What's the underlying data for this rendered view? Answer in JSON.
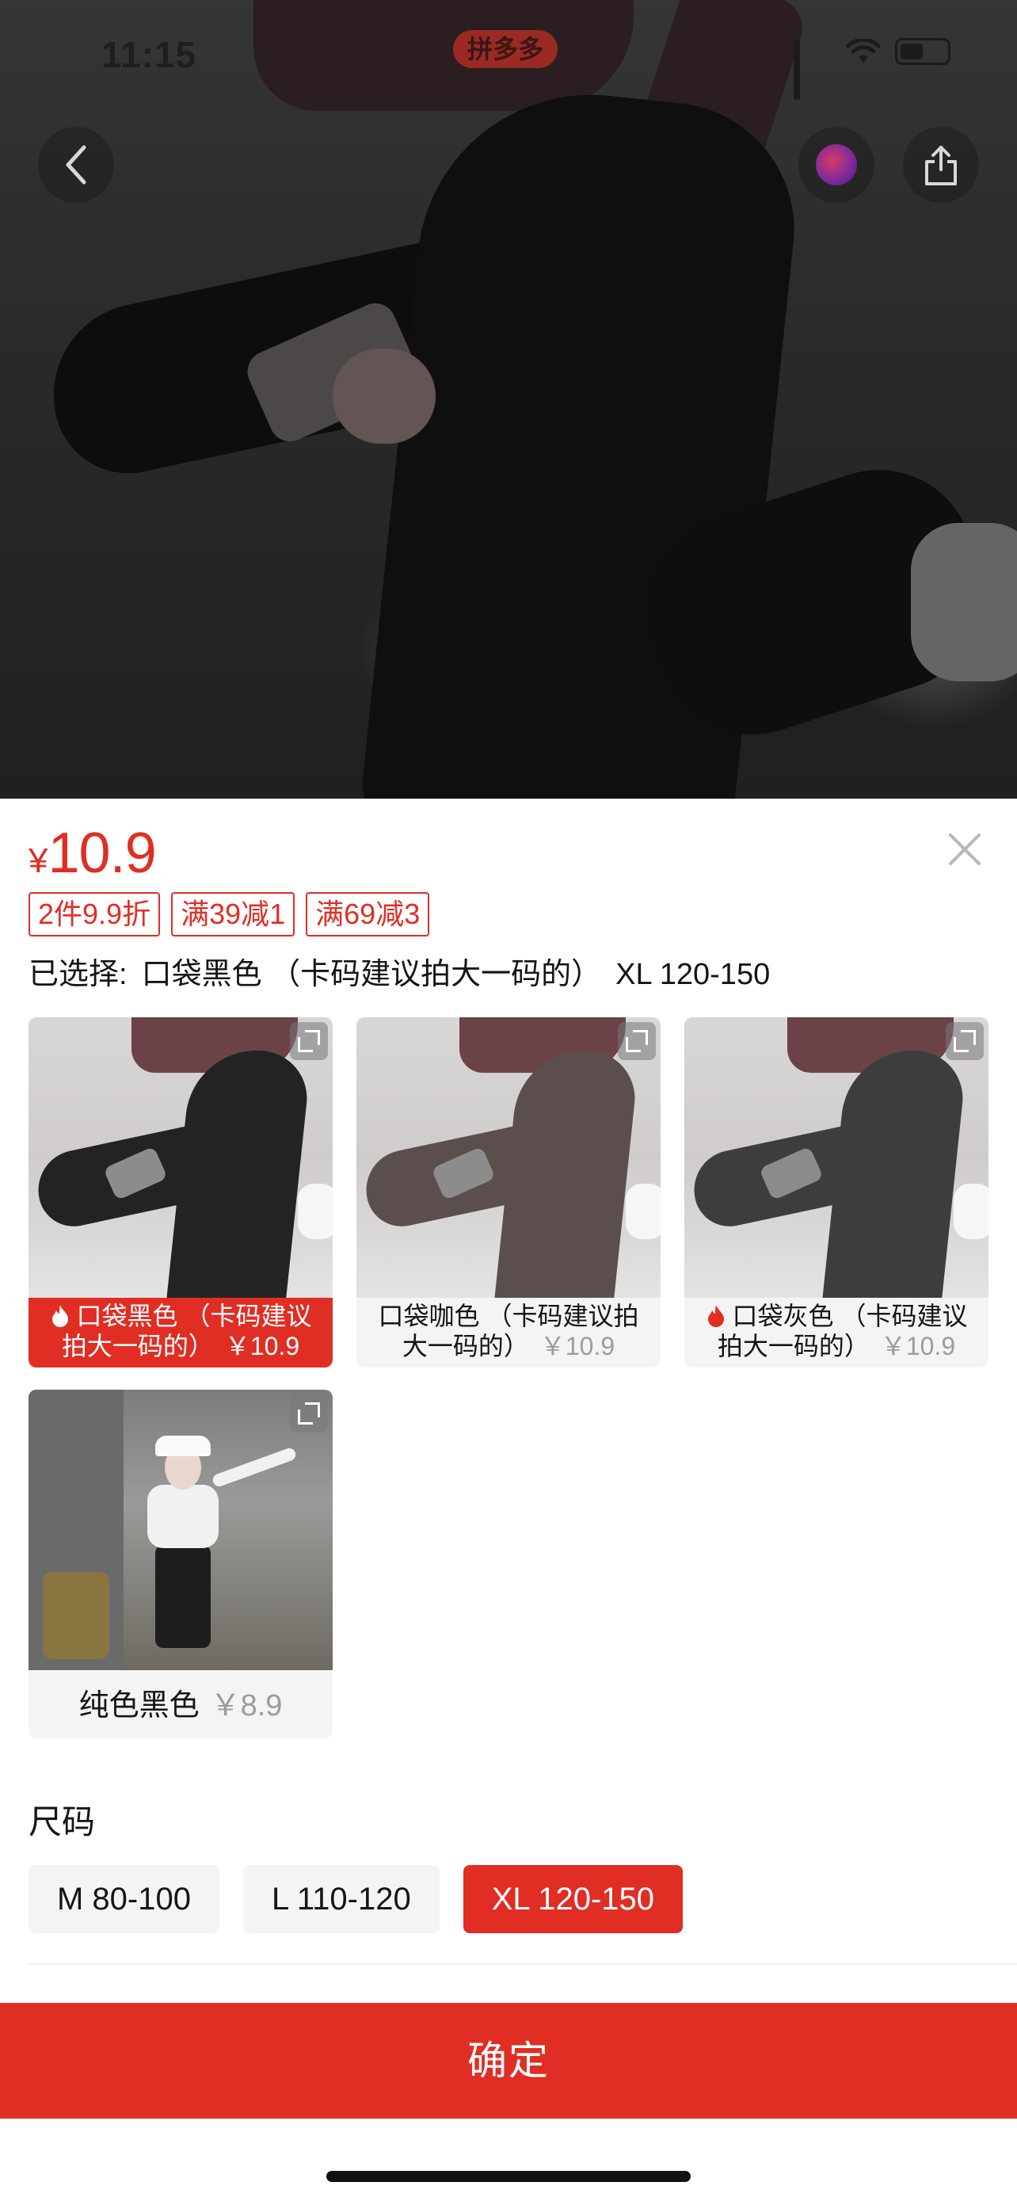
{
  "status_bar": {
    "time": "11:15",
    "app_badge": "拼多多",
    "icons": [
      "signal-icon",
      "wifi-icon",
      "battery-icon"
    ]
  },
  "header_buttons": {
    "back": "chevron-left-icon",
    "avatar": "avatar-icon",
    "share": "share-icon"
  },
  "sheet": {
    "price_symbol": "¥",
    "price_value": "10.9",
    "coupons": [
      "2件9.9折",
      "满39减1",
      "满69减3"
    ],
    "selected_label": "已选择:",
    "selected_color": "口袋黑色 （卡码建议拍大一码的）",
    "selected_size": "XL 120-150",
    "skus": [
      {
        "name": "口袋黑色 （卡码建议拍大一码的）",
        "price": "￥10.9",
        "hot": true,
        "active": true
      },
      {
        "name": "口袋咖色 （卡码建议拍大一码的）",
        "price": "￥10.9",
        "hot": false,
        "active": false
      },
      {
        "name": "口袋灰色 （卡码建议拍大一码的）",
        "price": "￥10.9",
        "hot": true,
        "active": false
      },
      {
        "name": "纯色黑色",
        "price": "￥8.9",
        "hot": false,
        "active": false
      }
    ],
    "size_title": "尺码",
    "sizes": [
      {
        "label": "M 80-100",
        "active": false
      },
      {
        "label": "L 110-120",
        "active": false
      },
      {
        "label": "XL 120-150",
        "active": true
      }
    ],
    "confirm_label": "确定"
  },
  "colors": {
    "accent": "#e02e24",
    "muted_text": "#9c9c9c",
    "chip_bg": "#f4f4f4"
  }
}
